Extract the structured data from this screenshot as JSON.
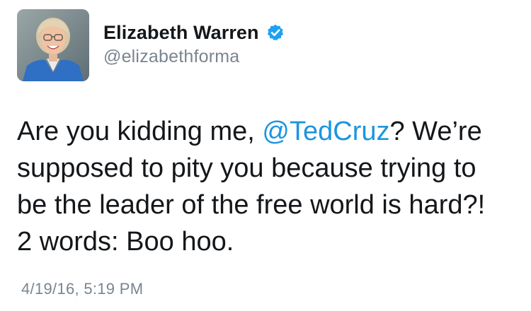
{
  "tweet": {
    "author": {
      "display_name": "Elizabeth Warren",
      "handle": "@elizabethforma",
      "verified": true,
      "avatar_icon": "profile-photo"
    },
    "body": {
      "line1_before": "Are you kidding me, ",
      "mention": "@TedCruz",
      "line1_after": "? We’re",
      "line2": "supposed to pity you because trying to",
      "line3": "be the leader of the free world is hard?!",
      "line4": "2 words: Boo hoo."
    },
    "timestamp": "4/19/16, 5:19 PM"
  },
  "colors": {
    "text": "#14171a",
    "secondary_text": "#7a8490",
    "link": "#1b95e0",
    "verified_badge": "#1da1f2"
  }
}
